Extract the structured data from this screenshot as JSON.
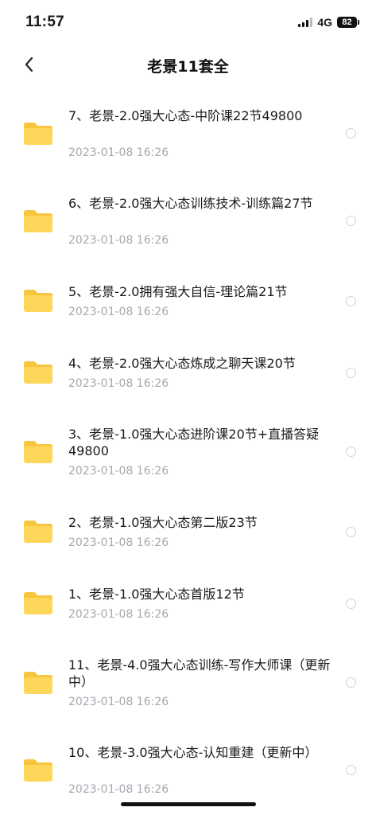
{
  "status_bar": {
    "time": "11:57",
    "network": "4G",
    "battery": "82"
  },
  "nav": {
    "title": "老景11套全",
    "back_icon": "chevron-left-icon"
  },
  "files": [
    {
      "name": "7、老景-2.0强大心态-中阶课22节49800",
      "date": "2023-01-08 16:26"
    },
    {
      "name": "6、老景-2.0强大心态训练技术-训练篇27节",
      "date": "2023-01-08 16:26"
    },
    {
      "name": "5、老景-2.0拥有强大自信-理论篇21节",
      "date": "2023-01-08 16:26"
    },
    {
      "name": "4、老景-2.0强大心态炼成之聊天课20节",
      "date": "2023-01-08 16:26"
    },
    {
      "name": "3、老景-1.0强大心态进阶课20节+直播答疑49800",
      "date": "2023-01-08 16:26"
    },
    {
      "name": "2、老景-1.0强大心态第二版23节",
      "date": "2023-01-08 16:26"
    },
    {
      "name": "1、老景-1.0强大心态首版12节",
      "date": "2023-01-08 16:26"
    },
    {
      "name": "11、老景-4.0强大心态训练-写作大师课（更新中）",
      "date": "2023-01-08 16:26"
    },
    {
      "name": "10、老景-3.0强大心态-认知重建（更新中）",
      "date": "2023-01-08 16:26"
    }
  ],
  "colors": {
    "folder_body": "#FCD75A",
    "folder_tab": "#F7C63E",
    "date_text": "#A4A8B0",
    "radio_border": "#CFD2D6"
  }
}
